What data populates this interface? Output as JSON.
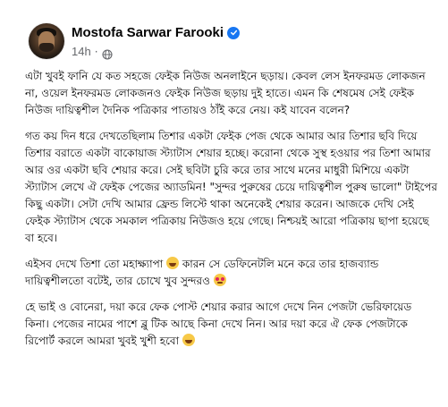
{
  "post": {
    "author_name": "Mostofa Sarwar Farooki",
    "timestamp": "14h",
    "separator": "·",
    "paragraphs": [
      "এটা খুবই ফানি যে কত সহজে ফেইক নিউজ অনলাইনে ছড়ায়। কেবল লেস ইনফরমড লোকজন না, ওয়েল ইনফরমড লোকজনও ফেইক নিউজ ছড়ায় দুই হাতে। এমন কি শেষমেষ সেই ফেইক নিউজ দায়িত্বশীল দৈনিক পত্রিকার পাতায়ও ঠাঁই করে নেয়। কই যাবেন বলেন?",
      "গত কয় দিন ধরে দেখতেছিলাম তিশার একটা ফেইক পেজ থেকে আমার আর তিশার ছবি দিয়ে তিশার বরাতে একটা বাকোয়াজ স্ট্যাটাস শেয়ার হচ্ছে। করোনা থেকে সুস্থ হওয়ার পর তিশা আমার আর ওর একটা ছবি শেয়ার করে। সেই ছবিটা চুরি করে তার সাথে মনের মাধুরী মিশিয়ে একটা স্ট্যাটাস লেখে ঐ ফেইক পেজের অ্যাডমিন! \"সুন্দর পুরুষের চেয়ে দায়িত্বশীল পুরুষ ভালো\" টাইপের কিছু একটা। সেটা দেখি আমার ফ্রেন্ড লিস্টে থাকা অনেকেই শেয়ার করেন। আজকে দেখি সেই ফেইক স্ট্যাটাস থেকে সমকাল পত্রিকায় নিউজও হয়ে গেছে। নিশ্চয়ই আরো পত্রিকায় ছাপা হয়েছে বা হবে।",
      "এইসব দেখে তিশা তো মহাক্ষ্যাপা",
      "হে ভাই ও বোনেরা, দয়া করে ফেক পোস্ট শেয়ার করার আগে দেখে নিন পেজটা ভেরিফায়েড কিনা। পেজের নামের পাশে ব্লু টিক আছে কিনা দেখে নিন। আর দয়া করে ঐ ফেক পেজটাকে রিপোর্ট করলে আমরা খুবই খুশী হবো"
    ],
    "para3_continuation": "কারন সে ডেফিনেটলি মনে করে তার হাজব্যান্ড দায়িত্বশীলতো বটেই, তার চোখে খুব সুন্দরও",
    "icons": {
      "verified": "verified-badge-icon",
      "privacy": "globe-icon",
      "emoji_grin": "grinning-face-icon",
      "emoji_love": "smiling-face-with-hearts-icon",
      "emoji_end": "grinning-face-icon"
    },
    "colors": {
      "verified_blue": "#1877f2",
      "secondary_text": "#65676b"
    }
  }
}
